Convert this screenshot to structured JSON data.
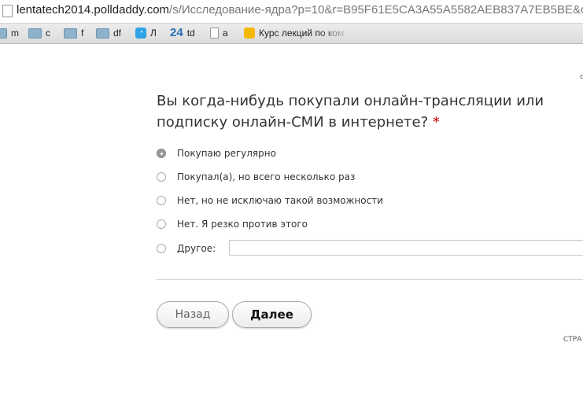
{
  "browser": {
    "url_host": "lentatech2014.polldaddy.com",
    "url_path": "/s/Исследование-ядра?p=10&r=B95F61E5CA3A55A5582AEB837A7EB5BE&c",
    "bookmarks": [
      {
        "label": "m",
        "icon": "folder-icon"
      },
      {
        "label": "c",
        "icon": "folder-icon"
      },
      {
        "label": "f",
        "icon": "folder-icon"
      },
      {
        "label": "df",
        "icon": "folder-icon"
      },
      {
        "label": "Л",
        "icon": "blue-app-icon"
      },
      {
        "label": "td",
        "icon": "24-icon",
        "icon_text": "24"
      },
      {
        "label": "a",
        "icon": "document-icon"
      },
      {
        "label": "Курс лекций по ком",
        "icon": "yellow-app-icon"
      }
    ]
  },
  "survey": {
    "top_right_partial": "с",
    "question": "Вы когда-нибудь покупали онлайн-трансляции или подписку онлайн-СМИ в интернете?",
    "required_mark": "*",
    "options": [
      {
        "label": "Покупаю регулярно",
        "selected": true
      },
      {
        "label": "Покупал(а), но всего несколько раз",
        "selected": false
      },
      {
        "label": "Нет, но не исключаю такой возможности",
        "selected": false
      },
      {
        "label": "Нет. Я резко против этого",
        "selected": false
      },
      {
        "label": "Другое:",
        "selected": false
      }
    ],
    "other_value": "",
    "back_label": "Назад",
    "next_label": "Далее",
    "page_indicator_partial": "СТРА"
  }
}
